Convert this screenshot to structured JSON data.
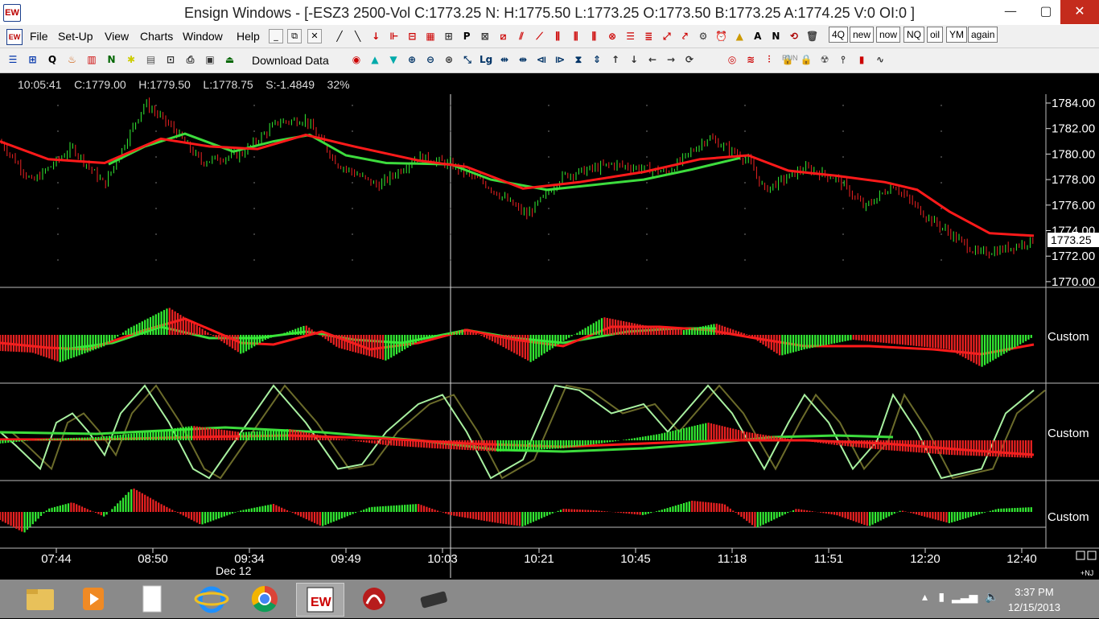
{
  "window": {
    "title": "Ensign Windows - [-ESZ3 2500-Vol C:1773.25 N: H:1775.50 L:1773.25 O:1773.50 B:1773.25 A:1774.25 V:0 OI:0 ]",
    "app_icon_text": "EW",
    "min_glyph": "—",
    "max_glyph": "▢",
    "close_glyph": "✕"
  },
  "menu": {
    "items": [
      "File",
      "Set-Up",
      "View",
      "Charts",
      "Window",
      "Help"
    ],
    "mdi_buttons": [
      "_",
      "⧉",
      "✕"
    ]
  },
  "quick_buttons": [
    "4Q",
    "new",
    "now",
    "NQ",
    "oil",
    "YM",
    "again"
  ],
  "toolbar2": {
    "download_label": "Download Data",
    "run_label": "RUN",
    "exit_label": "EXIT"
  },
  "chart": {
    "info": {
      "time": "10:05:41",
      "close": "C:1779.00",
      "high": "H:1779.50",
      "low": "L:1778.75",
      "spread": "S:-1.4849",
      "pct": "32%"
    },
    "price_axis": [
      "1784.00",
      "1782.00",
      "1780.00",
      "1778.00",
      "1776.00",
      "1774.00",
      "1772.00",
      "1770.00"
    ],
    "last_price": "1773.25",
    "panel_labels": [
      "Custom",
      "Custom",
      "Custom"
    ],
    "time_axis": [
      "07:44",
      "08:50",
      "09:34",
      "09:49",
      "10:03",
      "10:21",
      "10:45",
      "11:18",
      "11:51",
      "12:20",
      "12:40"
    ],
    "date_label": "Dec 12",
    "corner_label": "+NJ",
    "colors": {
      "up": "#33ee33",
      "down": "#ee2222",
      "avg": "#ff1a1a",
      "ma": "#3ddc3d",
      "osc_light": "#a8f0a0",
      "osc_dark": "#6b6b2a"
    }
  },
  "chart_data": {
    "type": "candlestick",
    "title": "-ESZ3 2500-Vol",
    "xlabel": "",
    "ylabel": "",
    "ylim": [
      1770,
      1784.5
    ],
    "x": [
      "07:44",
      "08:50",
      "09:34",
      "09:49",
      "10:03",
      "10:21",
      "10:45",
      "11:18",
      "11:51",
      "12:20",
      "12:40"
    ],
    "close": [
      1779.0,
      1783.2,
      1782.0,
      1778.7,
      1779.8,
      1775.6,
      1779.2,
      1781.3,
      1778.2,
      1774.8,
      1773.25
    ],
    "series": [
      {
        "name": "",
        "values": [
          1780.2,
          1781.8,
          1781.3,
          1780.0,
          1779.3,
          1777.2,
          1778.2,
          1779.9,
          1779.0,
          1777.0,
          1773.6
        ]
      }
    ]
  },
  "taskbar": {
    "apps": [
      "file-explorer",
      "media-player",
      "notepad",
      "internet-explorer",
      "chrome",
      "ensign-windows",
      "adobe",
      "device"
    ],
    "time": "3:37 PM",
    "date": "12/15/2013"
  }
}
